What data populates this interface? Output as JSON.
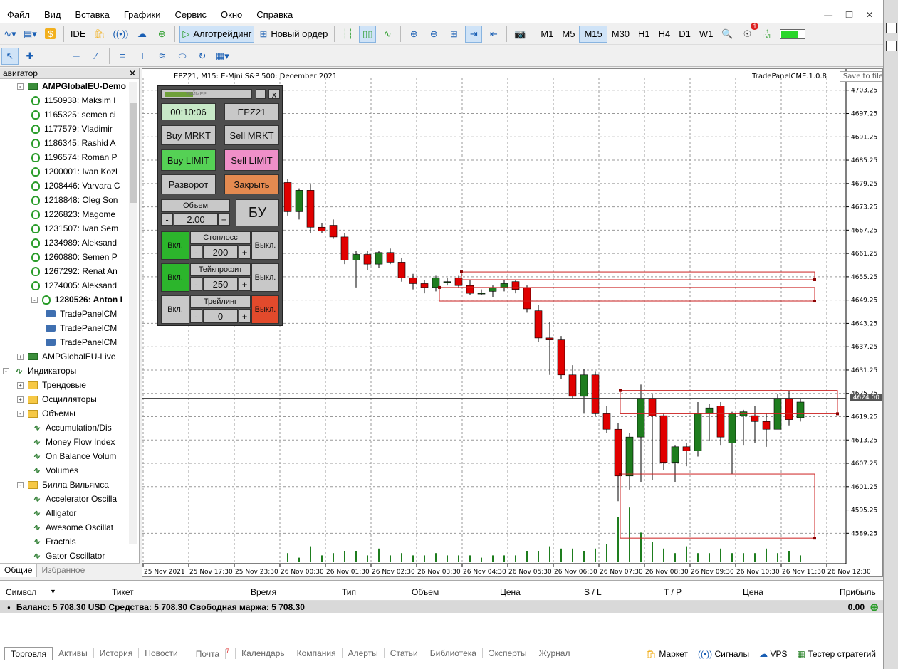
{
  "menu": {
    "items": [
      "Файл",
      "Вид",
      "Вставка",
      "Графики",
      "Сервис",
      "Окно",
      "Справка"
    ]
  },
  "toolbar": {
    "ide": "IDE",
    "algo": "Алготрейдинг",
    "new_order": "Новый ордер",
    "timeframes": [
      "M1",
      "M5",
      "M15",
      "M30",
      "H1",
      "H4",
      "D1",
      "W1"
    ],
    "active_tf": "M15",
    "alerts_badge": "1",
    "lvl": "LVL",
    "lvl_fill": 0.7
  },
  "navigator": {
    "title": "авигатор",
    "tabs": [
      "Общие",
      "Избранное"
    ],
    "rows": [
      {
        "t": "AMPGlobalEU-Demo",
        "lvl": 1,
        "icon": "acc",
        "bold": true,
        "exp": "-"
      },
      {
        "t": "1150938: Maksim I",
        "lvl": 2,
        "icon": "user"
      },
      {
        "t": "1165325: semen ci",
        "lvl": 2,
        "icon": "user"
      },
      {
        "t": "1177579: Vladimir",
        "lvl": 2,
        "icon": "user"
      },
      {
        "t": "1186345: Rashid A",
        "lvl": 2,
        "icon": "user"
      },
      {
        "t": "1196574: Roman P",
        "lvl": 2,
        "icon": "user"
      },
      {
        "t": "1200001: Ivan Kozl",
        "lvl": 2,
        "icon": "user"
      },
      {
        "t": "1208446: Varvara C",
        "lvl": 2,
        "icon": "user"
      },
      {
        "t": "1218848: Oleg Son",
        "lvl": 2,
        "icon": "user"
      },
      {
        "t": "1226823: Magome",
        "lvl": 2,
        "icon": "user"
      },
      {
        "t": "1231507: Ivan Sem",
        "lvl": 2,
        "icon": "user"
      },
      {
        "t": "1234989: Aleksand",
        "lvl": 2,
        "icon": "user"
      },
      {
        "t": "1260880: Semen P",
        "lvl": 2,
        "icon": "user"
      },
      {
        "t": "1267292: Renat An",
        "lvl": 2,
        "icon": "user"
      },
      {
        "t": "1274005: Aleksand",
        "lvl": 2,
        "icon": "user"
      },
      {
        "t": "1280526: Anton I",
        "lvl": 2,
        "icon": "user",
        "bold": true,
        "exp": "-"
      },
      {
        "t": "TradePanelCM",
        "lvl": 3,
        "icon": "cap"
      },
      {
        "t": "TradePanelCM",
        "lvl": 3,
        "icon": "cap"
      },
      {
        "t": "TradePanelCM",
        "lvl": 3,
        "icon": "cap"
      },
      {
        "t": "AMPGlobalEU-Live",
        "lvl": 1,
        "icon": "acc",
        "exp": "+"
      },
      {
        "t": "Индикаторы",
        "lvl": 0,
        "icon": "ind",
        "exp": "-"
      },
      {
        "t": "Трендовые",
        "lvl": 1,
        "icon": "folder",
        "exp": "+"
      },
      {
        "t": "Осцилляторы",
        "lvl": 1,
        "icon": "folder",
        "exp": "+"
      },
      {
        "t": "Объемы",
        "lvl": 1,
        "icon": "folder",
        "exp": "-"
      },
      {
        "t": "Accumulation/Dis",
        "lvl": 2,
        "icon": "ind"
      },
      {
        "t": "Money Flow Index",
        "lvl": 2,
        "icon": "ind"
      },
      {
        "t": "On Balance Volum",
        "lvl": 2,
        "icon": "ind"
      },
      {
        "t": "Volumes",
        "lvl": 2,
        "icon": "ind"
      },
      {
        "t": "Билла Вильямса",
        "lvl": 1,
        "icon": "folder",
        "exp": "-"
      },
      {
        "t": "Accelerator Oscilla",
        "lvl": 2,
        "icon": "ind"
      },
      {
        "t": "Alligator",
        "lvl": 2,
        "icon": "ind"
      },
      {
        "t": "Awesome Oscillat",
        "lvl": 2,
        "icon": "ind"
      },
      {
        "t": "Fractals",
        "lvl": 2,
        "icon": "ind"
      },
      {
        "t": "Gator Oscillator",
        "lvl": 2,
        "icon": "ind"
      }
    ]
  },
  "chart": {
    "title": "EPZ21, M15:  E-Mini S&P 500: December 2021",
    "expert": "TradePanelCME.1.0.8",
    "save": "Save to file",
    "price_badge": "4624.00",
    "y_labels": [
      "4703.25",
      "4697.25",
      "4691.25",
      "4685.25",
      "4679.25",
      "4673.25",
      "4667.25",
      "4661.25",
      "4655.25",
      "4649.25",
      "4643.25",
      "4637.25",
      "4631.25",
      "4625.25",
      "4619.25",
      "4613.25",
      "4607.25",
      "4601.25",
      "4595.25",
      "4589.25"
    ],
    "x_labels": [
      "25 Nov 2021",
      "25 Nov 17:30",
      "25 Nov 23:30",
      "26 Nov 00:30",
      "26 Nov 01:30",
      "26 Nov 02:30",
      "26 Nov 03:30",
      "26 Nov 04:30",
      "26 Nov 05:30",
      "26 Nov 06:30",
      "26 Nov 07:30",
      "26 Nov 08:30",
      "26 Nov 09:30",
      "26 Nov 10:30",
      "26 Nov 11:30",
      "26 Nov 12:30"
    ],
    "bull_color": "#1e7d1e",
    "bear_color": "#e00000"
  },
  "chart_data": {
    "type": "candlestick",
    "symbol": "EPZ21",
    "timeframe": "M15",
    "ohlc": [
      [
        4679.5,
        4680.5,
        4671.0,
        4672.0
      ],
      [
        4672.0,
        4678.0,
        4670.0,
        4677.5
      ],
      [
        4677.5,
        4679.0,
        4666.5,
        4668.0
      ],
      [
        4668.0,
        4669.0,
        4666.5,
        4667.0
      ],
      [
        4668.5,
        4670.0,
        4665.0,
        4665.5
      ],
      [
        4665.5,
        4666.5,
        4658.5,
        4659.5
      ],
      [
        4659.5,
        4662.0,
        4652.5,
        4661.0
      ],
      [
        4661.0,
        4662.0,
        4657.0,
        4658.5
      ],
      [
        4658.5,
        4662.0,
        4657.5,
        4661.5
      ],
      [
        4661.5,
        4662.5,
        4658.5,
        4659.0
      ],
      [
        4659.0,
        4660.0,
        4654.0,
        4655.0
      ],
      [
        4655.0,
        4656.0,
        4652.0,
        4653.5
      ],
      [
        4653.5,
        4654.5,
        4651.0,
        4652.5
      ],
      [
        4652.5,
        4655.5,
        4651.5,
        4655.0
      ],
      [
        4654.0,
        4655.0,
        4653.0,
        4654.0
      ],
      [
        4655.0,
        4655.5,
        4652.5,
        4653.0
      ],
      [
        4653.0,
        4654.5,
        4650.5,
        4651.0
      ],
      [
        4651.0,
        4652.0,
        4650.5,
        4651.0
      ],
      [
        4651.5,
        4653.0,
        4650.0,
        4652.5
      ],
      [
        4652.5,
        4654.5,
        4651.5,
        4653.5
      ],
      [
        4654.0,
        4654.5,
        4651.0,
        4652.0
      ],
      [
        4652.5,
        4653.0,
        4646.0,
        4647.0
      ],
      [
        4646.5,
        4648.0,
        4638.5,
        4639.5
      ],
      [
        4639.5,
        4643.5,
        4630.0,
        4639.0
      ],
      [
        4639.0,
        4640.0,
        4629.0,
        4630.0
      ],
      [
        4630.0,
        4632.5,
        4624.0,
        4624.5
      ],
      [
        4624.5,
        4631.5,
        4620.0,
        4630.0
      ],
      [
        4630.0,
        4631.0,
        4619.5,
        4620.0
      ],
      [
        4620.0,
        4622.0,
        4615.0,
        4616.0
      ],
      [
        4616.0,
        4617.5,
        4597.5,
        4604.0
      ],
      [
        4604.0,
        4615.0,
        4600.5,
        4614.0
      ],
      [
        4614.0,
        4627.5,
        4602.5,
        4624.0
      ],
      [
        4624.0,
        4625.0,
        4603.0,
        4619.5
      ],
      [
        4619.5,
        4620.0,
        4605.5,
        4607.5
      ],
      [
        4607.5,
        4612.0,
        4602.5,
        4611.5
      ],
      [
        4611.5,
        4612.5,
        4606.5,
        4610.5
      ],
      [
        4610.5,
        4623.0,
        4609.0,
        4620.0
      ],
      [
        4620.0,
        4622.5,
        4613.0,
        4621.5
      ],
      [
        4622.0,
        4623.0,
        4612.0,
        4614.0
      ],
      [
        4612.5,
        4620.5,
        4604.5,
        4620.0
      ],
      [
        4619.5,
        4621.0,
        4612.0,
        4620.5
      ],
      [
        4619.5,
        4622.0,
        4612.5,
        4618.0
      ],
      [
        4618.0,
        4620.0,
        4611.5,
        4616.0
      ],
      [
        4616.0,
        4625.0,
        4616.0,
        4624.0
      ],
      [
        4624.0,
        4626.0,
        4617.0,
        4618.5
      ],
      [
        4619.0,
        4624.0,
        4618.0,
        4623.0
      ]
    ],
    "volumes": [
      4,
      2,
      7,
      3,
      4,
      5,
      5,
      3,
      6,
      3,
      4,
      3,
      3,
      4,
      3,
      3,
      3,
      2,
      3,
      3,
      3,
      5,
      5,
      7,
      6,
      6,
      5,
      6,
      8,
      20,
      24,
      13,
      9,
      6,
      4,
      7,
      4,
      4,
      6,
      4,
      4,
      4,
      6,
      4,
      5,
      3
    ],
    "order_levels": [
      4656.5,
      4654.5,
      4652.5,
      4649.0,
      4626.0,
      4620.0,
      4604.5,
      4588.0
    ],
    "current_price": 4624.0
  },
  "panel": {
    "timer_label": "ТАЙМЕР",
    "timer": "00:10:06",
    "symbol": "EPZ21",
    "buy_mrkt": "Buy MRKT",
    "sell_mrkt": "Sell MRKT",
    "buy_limit": "Buy LIMIT",
    "sell_limit": "Sell LIMIT",
    "reverse": "Разворот",
    "close": "Закрыть",
    "volume_label": "Объем",
    "volume": "2.00",
    "be": "БУ",
    "stoploss_label": "Стоплосс",
    "stoploss": "200",
    "takeprofit_label": "Тейкпрофит",
    "takeprofit": "250",
    "trailing_label": "Трейлинг",
    "trailing": "0",
    "on": "Вкл.",
    "off": "Выкл.",
    "minus": "-",
    "plus": "+",
    "close_x": "x"
  },
  "terminal": {
    "headers": [
      "Символ",
      "Тикет",
      "Время",
      "Тип",
      "Объем",
      "Цена",
      "S / L",
      "T / P",
      "Цена",
      "Прибыль"
    ],
    "balance": "Баланс: 5 708.30 USD  Средства: 5 708.30  Свободная маржа: 5 708.30",
    "profit": "0.00",
    "tabs": [
      "Торговля",
      "Активы",
      "История",
      "Новости",
      "Почта",
      "Календарь",
      "Компания",
      "Алерты",
      "Статьи",
      "Библиотека",
      "Эксперты",
      "Журнал"
    ],
    "mail_badge": "7",
    "right": [
      "Маркет",
      "Сигналы",
      "VPS",
      "Тестер стратегий"
    ]
  }
}
